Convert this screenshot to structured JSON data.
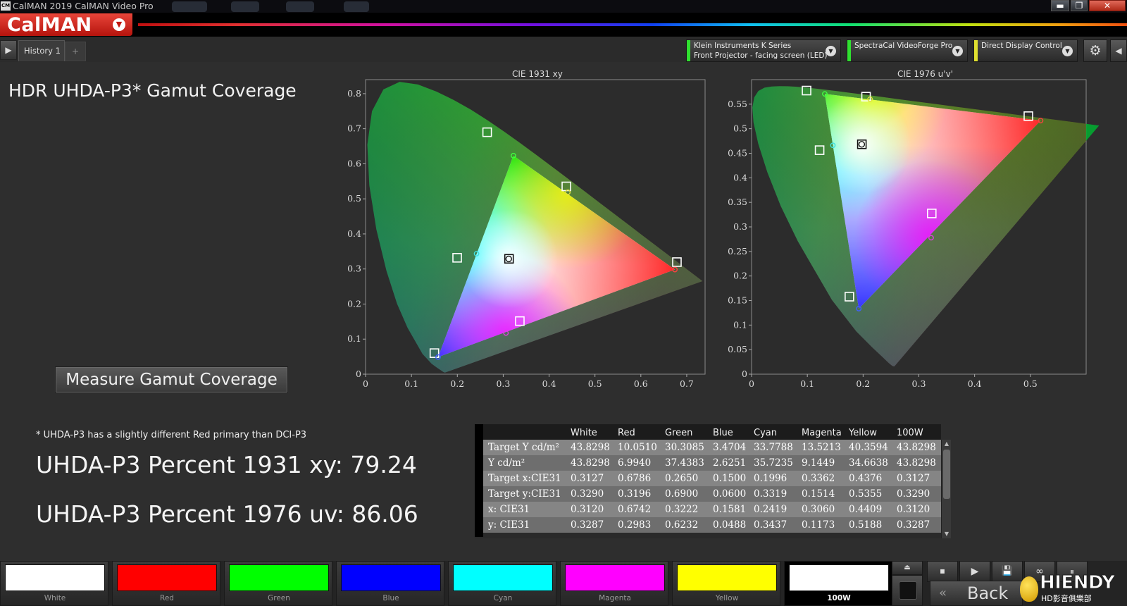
{
  "window": {
    "title": "CalMAN 2019 CalMAN Video Pro",
    "icon_text": "CM",
    "controls": {
      "minimize": "▬",
      "maximize": "❐",
      "close": "✕"
    }
  },
  "brand": {
    "logo": "CalMAN",
    "menu_icon": "chevron-down-icon"
  },
  "tabs": {
    "nav_icon": "play-icon",
    "history_label": "History 1",
    "add_label": "+"
  },
  "devices": [
    {
      "line1": "Klein Instruments K Series",
      "line2": "Front Projector - facing screen (LED)",
      "status_color": "#30e030"
    },
    {
      "line1": "SpectraCal VideoForge Pro",
      "line2": "",
      "status_color": "#30e030"
    },
    {
      "line1": "Direct Display Control",
      "line2": "",
      "status_color": "#e0e030"
    }
  ],
  "page": {
    "title": "HDR UHDA-P3* Gamut Coverage",
    "measure_button": "Measure Gamut Coverage",
    "footnote": "* UHDA-P3 has a slightly different Red primary than DCI-P3",
    "percent_1931_label": "UHDA-P3 Percent 1931 xy: 79.24",
    "percent_1976_label": "UHDA-P3 Percent 1976 uv: 86.06"
  },
  "chart_data": [
    {
      "type": "scatter",
      "title": "CIE 1931 xy",
      "x_ticks": [
        "0",
        "0.1",
        "0.2",
        "0.3",
        "0.4",
        "0.5",
        "0.6",
        "0.7"
      ],
      "y_ticks": [
        "0",
        "0.1",
        "0.2",
        "0.3",
        "0.4",
        "0.5",
        "0.6",
        "0.7",
        "0.8"
      ],
      "xlim": [
        0,
        0.74
      ],
      "ylim": [
        0,
        0.84
      ],
      "targets": [
        {
          "name": "Red",
          "x": 0.6786,
          "y": 0.3196
        },
        {
          "name": "Green",
          "x": 0.265,
          "y": 0.69
        },
        {
          "name": "Blue",
          "x": 0.15,
          "y": 0.06
        },
        {
          "name": "Cyan",
          "x": 0.1996,
          "y": 0.3319
        },
        {
          "name": "Magenta",
          "x": 0.3362,
          "y": 0.1514
        },
        {
          "name": "Yellow",
          "x": 0.4376,
          "y": 0.5355
        },
        {
          "name": "White",
          "x": 0.3127,
          "y": 0.329
        }
      ],
      "measured": [
        {
          "name": "Red",
          "x": 0.6742,
          "y": 0.2983,
          "color": "#ff4040"
        },
        {
          "name": "Green",
          "x": 0.3222,
          "y": 0.6232,
          "color": "#40ff40"
        },
        {
          "name": "Blue",
          "x": 0.1581,
          "y": 0.0488,
          "color": "#4060ff"
        },
        {
          "name": "Cyan",
          "x": 0.2419,
          "y": 0.3437,
          "color": "#40e0e0"
        },
        {
          "name": "Magenta",
          "x": 0.306,
          "y": 0.1173,
          "color": "#e040e0"
        },
        {
          "name": "Yellow",
          "x": 0.4409,
          "y": 0.5188,
          "color": "#e0e040"
        },
        {
          "name": "White",
          "x": 0.312,
          "y": 0.3287,
          "color": "#ffffff"
        }
      ]
    },
    {
      "type": "scatter",
      "title": "CIE 1976 u'v'",
      "x_ticks": [
        "0",
        "0.1",
        "0.2",
        "0.3",
        "0.4",
        "0.5"
      ],
      "y_ticks": [
        "0",
        "0.05",
        "0.1",
        "0.15",
        "0.2",
        "0.25",
        "0.3",
        "0.35",
        "0.4",
        "0.45",
        "0.5",
        "0.55"
      ],
      "xlim": [
        0,
        0.6
      ],
      "ylim": [
        0,
        0.6
      ],
      "targets": [
        {
          "name": "Red",
          "u": 0.4964,
          "v": 0.5256
        },
        {
          "name": "Green",
          "u": 0.0986,
          "v": 0.5777
        },
        {
          "name": "Blue",
          "u": 0.1754,
          "v": 0.1579
        },
        {
          "name": "Cyan",
          "u": 0.122,
          "v": 0.4563
        },
        {
          "name": "Magenta",
          "u": 0.3231,
          "v": 0.3274
        },
        {
          "name": "Yellow",
          "u": 0.2053,
          "v": 0.5653
        },
        {
          "name": "White",
          "u": 0.1978,
          "v": 0.4683
        }
      ],
      "measured": [
        {
          "name": "Red",
          "u": 0.5184,
          "v": 0.5165,
          "color": "#ff4040"
        },
        {
          "name": "Green",
          "u": 0.1313,
          "v": 0.5709,
          "color": "#40ff40"
        },
        {
          "name": "Blue",
          "u": 0.1923,
          "v": 0.1335,
          "color": "#4060ff"
        },
        {
          "name": "Cyan",
          "u": 0.1458,
          "v": 0.4661,
          "color": "#40e0e0"
        },
        {
          "name": "Magenta",
          "u": 0.322,
          "v": 0.2779,
          "color": "#e040e0"
        },
        {
          "name": "Yellow",
          "u": 0.2125,
          "v": 0.5601,
          "color": "#e0e040"
        },
        {
          "name": "White",
          "u": 0.1975,
          "v": 0.4682,
          "color": "#ffffff"
        }
      ]
    }
  ],
  "table": {
    "columns": [
      "White",
      "Red",
      "Green",
      "Blue",
      "Cyan",
      "Magenta",
      "Yellow",
      "100W"
    ],
    "rows": [
      {
        "label": "Target Y cd/m²",
        "values": [
          "43.8298",
          "10.0510",
          "30.3085",
          "3.4704",
          "33.7788",
          "13.5213",
          "40.3594",
          "43.8298"
        ]
      },
      {
        "label": "Y cd/m²",
        "values": [
          "43.8298",
          "6.9940",
          "37.4383",
          "2.6251",
          "35.7235",
          "9.1449",
          "34.6638",
          "43.8298"
        ]
      },
      {
        "label": "Target x:CIE31",
        "values": [
          "0.3127",
          "0.6786",
          "0.2650",
          "0.1500",
          "0.1996",
          "0.3362",
          "0.4376",
          "0.3127"
        ]
      },
      {
        "label": "Target y:CIE31",
        "values": [
          "0.3290",
          "0.3196",
          "0.6900",
          "0.0600",
          "0.3319",
          "0.1514",
          "0.5355",
          "0.3290"
        ]
      },
      {
        "label": "x: CIE31",
        "values": [
          "0.3120",
          "0.6742",
          "0.3222",
          "0.1581",
          "0.2419",
          "0.3060",
          "0.4409",
          "0.3120"
        ]
      },
      {
        "label": "y: CIE31",
        "values": [
          "0.3287",
          "0.2983",
          "0.6232",
          "0.0488",
          "0.3437",
          "0.1173",
          "0.5188",
          "0.3287"
        ]
      }
    ]
  },
  "swatches": [
    {
      "label": "White",
      "color": "#ffffff",
      "active": false
    },
    {
      "label": "Red",
      "color": "#ff0000",
      "active": false
    },
    {
      "label": "Green",
      "color": "#00ff00",
      "active": false
    },
    {
      "label": "Blue",
      "color": "#0000ff",
      "active": false
    },
    {
      "label": "Cyan",
      "color": "#00ffff",
      "active": false
    },
    {
      "label": "Magenta",
      "color": "#ff00ff",
      "active": false
    },
    {
      "label": "Yellow",
      "color": "#ffff00",
      "active": false
    },
    {
      "label": "100W",
      "color": "#ffffff",
      "active": true
    }
  ],
  "controls": {
    "back_label": "Back",
    "icons": [
      "eject-icon",
      "stop-icon",
      "play-icon",
      "save-icon",
      "loop-icon",
      "pause-icon"
    ]
  },
  "watermark": {
    "name": "HIENDY",
    "sub": "HD影音俱樂部"
  }
}
